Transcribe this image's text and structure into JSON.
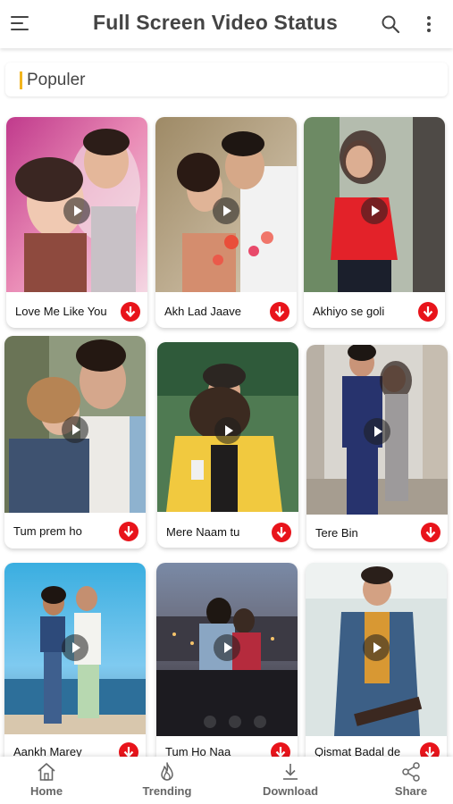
{
  "app_bar": {
    "title": "Full Screen Video Status",
    "menu_icon": "hamburger-menu-icon",
    "search_icon": "search-icon",
    "more_icon": "more-vertical-icon"
  },
  "section": {
    "title": "Populer",
    "accent_color": "#f2b51e"
  },
  "videos": [
    {
      "title": "Love Me Like You"
    },
    {
      "title": "Akh Lad Jaave"
    },
    {
      "title": "Akhiyo se goli"
    },
    {
      "title": "Tum prem ho"
    },
    {
      "title": "Mere Naam tu"
    },
    {
      "title": "Tere Bin"
    },
    {
      "title": "Aankh Marey"
    },
    {
      "title": "Tum Ho Naa"
    },
    {
      "title": "Qismat Badal de"
    }
  ],
  "download_color": "#e8141b",
  "bottom_nav": [
    {
      "label": "Home",
      "icon": "home-icon"
    },
    {
      "label": "Trending",
      "icon": "flame-icon"
    },
    {
      "label": "Download",
      "icon": "download-icon"
    },
    {
      "label": "Share",
      "icon": "share-icon"
    }
  ]
}
